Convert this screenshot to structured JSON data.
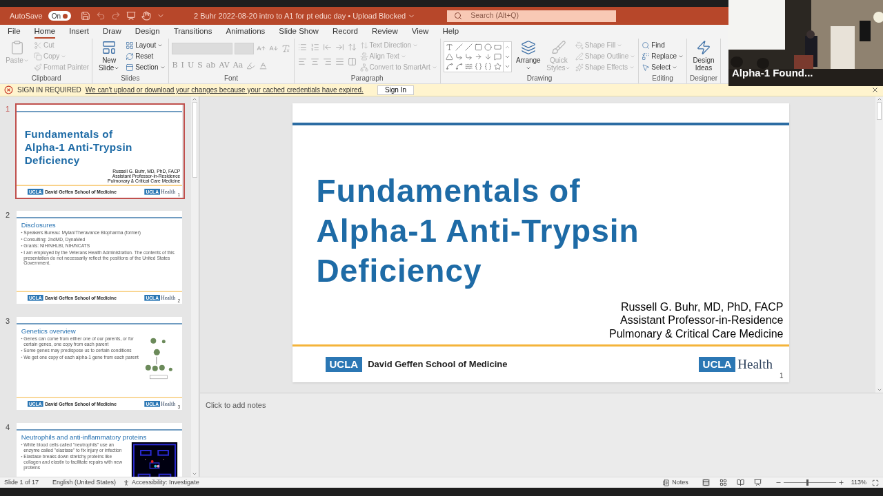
{
  "title_bar": {
    "autosave_label": "AutoSave",
    "autosave": {
      "on": true,
      "text": "On"
    },
    "document_title": "2 Buhr 2022-08-20 intro to A1 for pt educ day • Upload Blocked",
    "search_placeholder": "Search (Alt+Q)"
  },
  "menu_tabs": [
    {
      "label": "File",
      "selected": false
    },
    {
      "label": "Home",
      "selected": true
    },
    {
      "label": "Insert",
      "selected": false
    },
    {
      "label": "Draw",
      "selected": false
    },
    {
      "label": "Design",
      "selected": false
    },
    {
      "label": "Transitions",
      "selected": false
    },
    {
      "label": "Animations",
      "selected": false
    },
    {
      "label": "Slide Show",
      "selected": false
    },
    {
      "label": "Record",
      "selected": false
    },
    {
      "label": "Review",
      "selected": false
    },
    {
      "label": "View",
      "selected": false
    },
    {
      "label": "Help",
      "selected": false
    }
  ],
  "ribbon_groups": [
    {
      "label": "Clipboard",
      "blocks": [
        {
          "kind": "large",
          "items": [
            {
              "label": "Paste",
              "disabled": true,
              "has_menu": true
            }
          ]
        },
        {
          "kind": "stack",
          "items": [
            {
              "label": "Cut",
              "disabled": true,
              "has_menu": false
            },
            {
              "label": "Copy",
              "disabled": true,
              "has_menu": true
            },
            {
              "label": "Format Painter",
              "disabled": true,
              "has_menu": false
            }
          ]
        }
      ]
    },
    {
      "label": "Slides",
      "blocks": [
        {
          "kind": "large",
          "items": [
            {
              "label": "New Slide",
              "disabled": false,
              "has_menu": true
            }
          ]
        },
        {
          "kind": "stack",
          "items": [
            {
              "label": "Layout",
              "disabled": false,
              "has_menu": true
            },
            {
              "label": "Reset",
              "disabled": false,
              "has_menu": false
            },
            {
              "label": "Section",
              "disabled": false,
              "has_menu": true
            }
          ]
        }
      ]
    },
    {
      "label": "Font",
      "blocks": [
        {
          "kind": "rows",
          "rows": [
            [
              {
                "kind": "field",
                "disabled": true
              },
              {
                "kind": "field",
                "disabled": true
              },
              {
                "kind": "icon",
                "disabled": true
              },
              {
                "kind": "icon",
                "disabled": true
              },
              {
                "kind": "icon",
                "disabled": true
              }
            ],
            [
              {
                "kind": "glyph",
                "label": "B",
                "disabled": true
              },
              {
                "kind": "glyph",
                "label": "I",
                "disabled": true
              },
              {
                "kind": "glyph",
                "label": "U",
                "disabled": true
              },
              {
                "kind": "glyph",
                "label": "S",
                "disabled": true
              },
              {
                "kind": "glyph",
                "label": "ab",
                "disabled": true
              },
              {
                "kind": "glyph",
                "label": "AV",
                "disabled": true
              },
              {
                "kind": "glyph",
                "label": "Aa",
                "disabled": true
              },
              {
                "kind": "icon",
                "disabled": true
              },
              {
                "kind": "icon",
                "disabled": true
              }
            ]
          ]
        }
      ]
    },
    {
      "label": "Paragraph",
      "blocks": [
        {
          "kind": "rows",
          "rows": [
            [
              {
                "kind": "icon",
                "disabled": true
              },
              {
                "kind": "icon",
                "disabled": true
              },
              {
                "kind": "icon",
                "disabled": true
              },
              {
                "kind": "icon",
                "disabled": true
              },
              {
                "kind": "icon",
                "disabled": true
              }
            ],
            [
              {
                "kind": "icon",
                "disabled": true
              },
              {
                "kind": "icon",
                "disabled": true
              },
              {
                "kind": "icon",
                "disabled": true
              },
              {
                "kind": "icon",
                "disabled": true
              },
              {
                "kind": "icon",
                "disabled": true
              }
            ]
          ]
        },
        {
          "kind": "stack",
          "items": [
            {
              "label": "Text Direction",
              "disabled": true,
              "has_menu": true
            },
            {
              "label": "Align Text",
              "disabled": true,
              "has_menu": true
            },
            {
              "label": "Convert to SmartArt",
              "disabled": true,
              "has_menu": true
            }
          ]
        }
      ]
    },
    {
      "label": "Drawing",
      "blocks": [
        {
          "kind": "gallery"
        },
        {
          "kind": "large",
          "items": [
            {
              "label": "Arrange",
              "disabled": false,
              "has_menu": true
            }
          ]
        },
        {
          "kind": "large",
          "items": [
            {
              "label": "Quick Styles",
              "disabled": true,
              "has_menu": true
            }
          ]
        },
        {
          "kind": "stack",
          "items": [
            {
              "label": "Shape Fill",
              "disabled": true,
              "has_menu": true
            },
            {
              "label": "Shape Outline",
              "disabled": true,
              "has_menu": true
            },
            {
              "label": "Shape Effects",
              "disabled": true,
              "has_menu": true
            }
          ]
        }
      ]
    },
    {
      "label": "Editing",
      "blocks": [
        {
          "kind": "stack",
          "items": [
            {
              "label": "Find",
              "disabled": false,
              "has_menu": false
            },
            {
              "label": "Replace",
              "disabled": false,
              "has_menu": true
            },
            {
              "label": "Select",
              "disabled": false,
              "has_menu": true
            }
          ]
        }
      ]
    },
    {
      "label": "Designer",
      "blocks": [
        {
          "kind": "large",
          "items": [
            {
              "label": "Design Ideas",
              "disabled": false,
              "has_menu": false
            }
          ]
        }
      ]
    }
  ],
  "banner": {
    "title": "SIGN IN REQUIRED",
    "message": "We can't upload or download your changes because your cached credentials have expired.",
    "button": "Sign In"
  },
  "slides": [
    {
      "number": "1",
      "selected": true,
      "kind": "title",
      "title": "Fundamentals of\nAlpha-1 Anti-Trypsin\nDeficiency",
      "authors": [
        "Russell G. Buhr, MD, PhD, FACP",
        "Assistant Professor-in-Residence",
        "Pulmonary & Critical Care Medicine"
      ],
      "footer": {
        "school": "David Geffen School of Medicine",
        "badge": "UCLA",
        "badge_right": "UCLA",
        "health": "Health",
        "page": "1"
      }
    },
    {
      "number": "2",
      "selected": false,
      "kind": "bullets",
      "title": "Disclosures",
      "bullets": [
        "Speakers Bureau: Mylan/Theravance Biopharma (former)",
        "Consulting: 2ndMD, DynaMed",
        "Grants: NIH/NHLBI, NIH/NCATS",
        "I am employed by the Veterans Health Administration. The contents of this presentation do not necessarily reflect the positions of the United States Government."
      ],
      "footer": {
        "school": "David Geffen School of Medicine",
        "badge": "UCLA",
        "badge_right": "UCLA",
        "health": "Health",
        "page": "2"
      }
    },
    {
      "number": "3",
      "selected": false,
      "kind": "bullets",
      "title": "Genetics overview",
      "bullets": [
        "Genes can come from either one of our parents, or for certain genes, one copy from each parent",
        "Some genes may predispose us to certain conditions",
        "We get one copy of each alpha-1 gene from each parent"
      ],
      "picture": {
        "kind": "picture"
      },
      "footer": {
        "school": "David Geffen School of Medicine",
        "badge": "UCLA",
        "badge_right": "UCLA",
        "health": "Health",
        "page": "3"
      }
    },
    {
      "number": "4",
      "selected": false,
      "kind": "bullets",
      "title": "Neutrophils and anti-inflammatory proteins",
      "bullets": [
        "White blood cells called \"neutrophils\" use an enzyme called \"elastase\" to fix injury or infection",
        "Elastase breaks down stretchy proteins like collagen and elastin to facilitate repairs with new proteins"
      ],
      "picture": {
        "kind": "picture"
      }
    }
  ],
  "main_slide": {
    "kind": "title",
    "title": "Fundamentals of\nAlpha-1 Anti-Trypsin\nDeficiency",
    "authors": [
      "Russell G. Buhr, MD, PhD, FACP",
      "Assistant Professor-in-Residence",
      "Pulmonary & Critical Care Medicine"
    ],
    "footer": {
      "school": "David Geffen School of Medicine",
      "badge": "UCLA",
      "badge_right": "UCLA",
      "health": "Health",
      "page": "1"
    }
  },
  "notes_placeholder": "Click to add notes",
  "status_bar": {
    "slide_counter": "Slide 1 of 17",
    "language": "English (United States)",
    "accessibility": "Accessibility: Investigate",
    "notes": "Notes",
    "zoom_slider": {
      "level": 0.45
    },
    "zoom": "113%"
  },
  "video": {
    "label": "Alpha-1 Found..."
  }
}
